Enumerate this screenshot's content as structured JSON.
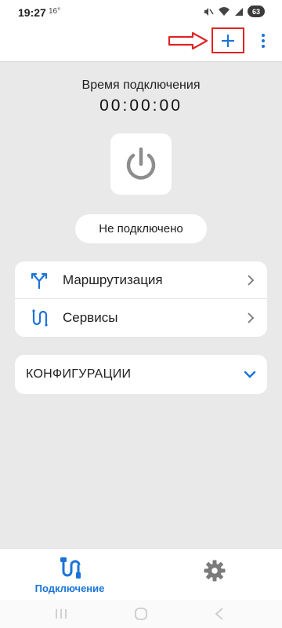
{
  "status_bar": {
    "time": "19:27",
    "temperature": "16°",
    "battery": "63"
  },
  "toolbar": {
    "add_label": "+",
    "accent_color": "#1a73d9",
    "annotation_color": "#e02424"
  },
  "connection": {
    "time_label": "Время подключения",
    "timer": "00:00:00",
    "status": "Не подключено"
  },
  "menu": {
    "items": [
      {
        "label": "Маршрутизация",
        "icon": "routing-icon"
      },
      {
        "label": "Сервисы",
        "icon": "services-icon"
      }
    ]
  },
  "configs": {
    "title": "КОНФИГУРАЦИИ",
    "expanded": false
  },
  "bottom_nav": {
    "items": [
      {
        "label": "Подключение",
        "icon": "connection-icon",
        "active": true
      },
      {
        "label": "",
        "icon": "gear-icon",
        "active": false
      }
    ]
  }
}
